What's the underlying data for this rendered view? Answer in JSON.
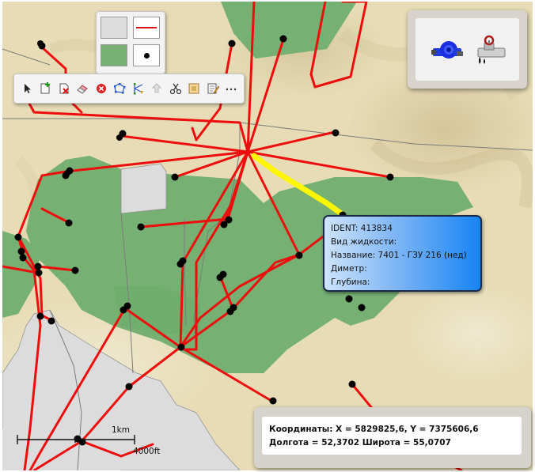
{
  "colors": {
    "pipeline": "#ee0d0d",
    "highlight": "#fff700",
    "vegetation": "#76b173",
    "urban": "#dcdcdc",
    "terrain": "#e7dcb6",
    "well": "#000000"
  },
  "style_panel": {
    "swatches": [
      "fill-swatch-gray",
      "line-swatch-red",
      "area-swatch-green",
      "point-swatch-black"
    ]
  },
  "toolbar": {
    "tools": [
      {
        "name": "select-tool",
        "icon": "cursor-icon"
      },
      {
        "name": "add-object-tool",
        "icon": "new-document-icon"
      },
      {
        "name": "delete-object-tool",
        "icon": "delete-document-icon"
      },
      {
        "name": "eraser-tool",
        "icon": "eraser-icon"
      },
      {
        "name": "cancel-tool",
        "icon": "red-x-icon"
      },
      {
        "name": "edit-vertices-tool",
        "icon": "polygon-vertices-icon"
      },
      {
        "name": "split-line-tool",
        "icon": "split-vertices-icon"
      },
      {
        "name": "move-tool",
        "icon": "move-icon"
      },
      {
        "name": "cut-tool",
        "icon": "scissors-icon"
      },
      {
        "name": "properties-tool",
        "icon": "properties-icon"
      },
      {
        "name": "edit-attributes-tool",
        "icon": "edit-notes-icon"
      },
      {
        "name": "more-tool",
        "icon": "ellipsis-icon"
      }
    ]
  },
  "layers": {
    "valve_icon": "blue-valve-icon",
    "pipe_icon": "leaking-pipe-icon"
  },
  "tooltip": {
    "ident": "IDENT: 413834",
    "fluid": "Вид жидкости:",
    "name": "Название: 7401 - ГЗУ 216 (нед)",
    "diameter": "Диметр:",
    "depth": "Глубина:"
  },
  "coordinates": {
    "xy": "Координаты: X = 5829825,6, Y = 7375606,6",
    "lonlat": "Долгота = 52,3702 Широта = 55,0707"
  },
  "scale": {
    "km_label": "1km",
    "ft_label": "4000ft"
  }
}
